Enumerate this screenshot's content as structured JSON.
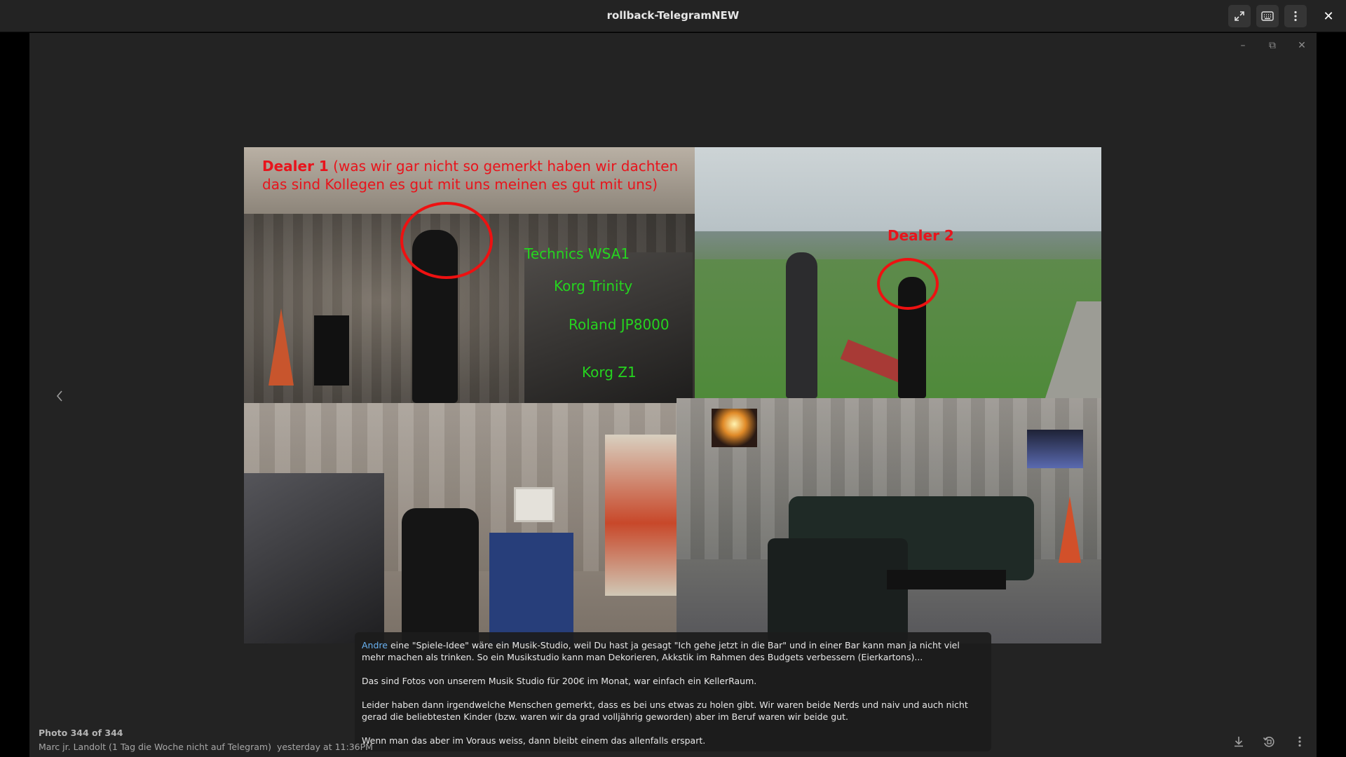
{
  "window": {
    "title": "rollback-TelegramNEW",
    "close_glyph": "✕"
  },
  "viewer_controls": {
    "minimize_glyph": "–",
    "restore_glyph": "⧉",
    "close_glyph": "✕"
  },
  "photo": {
    "annotations": {
      "dealer1_bold": "Dealer 1",
      "dealer1_line1_rest": " (was wir gar nicht so gemerkt haben wir dachten",
      "dealer1_line2": "das sind Kollegen  es gut mit uns meinen es gut mit uns)",
      "dealer2": "Dealer 2",
      "gear_1": "Technics WSA1",
      "gear_2": "Korg Trinity",
      "gear_3": "Roland  JP8000",
      "gear_4": "Korg Z1"
    },
    "colors": {
      "annotation_red": "#e8141c",
      "annotation_green": "#25d41f"
    }
  },
  "caption": {
    "mention": "Andre",
    "para1_rest": " eine \"Spiele-Idee\" wäre ein Musik-Studio, weil Du hast ja gesagt \"Ich gehe jetzt in die Bar\" und in einer Bar kann man ja nicht viel mehr machen als trinken. So ein Musikstudio kann man Dekorieren, Akkstik im Rahmen des Budgets verbessern (Eierkartons)...",
    "para2": "Das sind Fotos von unserem Musik Studio für 200€ im Monat, war einfach ein KellerRaum.",
    "para3": "Leider haben dann irgendwelche Menschen gemerkt, dass es bei uns etwas zu holen gibt. Wir waren beide Nerds und naiv und auch nicht gerad die beliebtesten Kinder (bzw. waren wir da grad volljährig geworden) aber im Beruf waren wir beide gut.",
    "para4": "Wenn man das aber im Voraus weiss, dann bleibt einem das allenfalls erspart.",
    "mention_color": "#6ab3f3"
  },
  "footer": {
    "photo_counter": "Photo 344 of 344",
    "sender": "Marc jr. Landolt (1 Tag die Woche nicht auf Telegram)",
    "timestamp": "yesterday at 11:36PM"
  },
  "icons": {
    "fullscreen": "expand-arrows-icon",
    "keyboard": "keyboard-icon",
    "menu": "vertical-dots-icon",
    "prev": "chevron-left-icon",
    "download": "download-icon",
    "rotate": "rotate-icon",
    "more": "vertical-dots-icon"
  }
}
